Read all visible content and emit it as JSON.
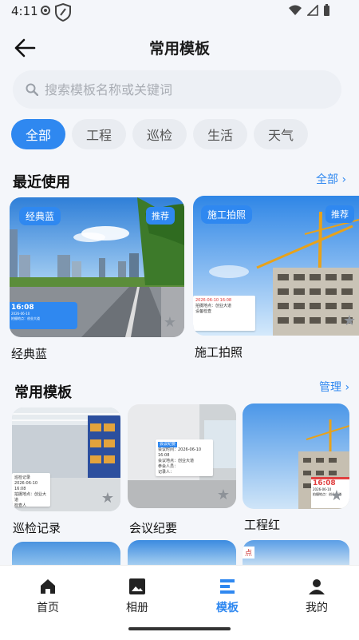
{
  "status": {
    "time": "4:11"
  },
  "header": {
    "title": "常用模板"
  },
  "search": {
    "placeholder": "搜索模板名称或关键词"
  },
  "chips": [
    "全部",
    "工程",
    "巡检",
    "生活",
    "天气"
  ],
  "recent": {
    "title": "最近使用",
    "more": "全部 ›",
    "cards": [
      {
        "label": "经典蓝",
        "tag": "经典蓝",
        "recommend": "推荐",
        "overlay_time": "16:08",
        "overlay_lines": [
          "2026-06-10",
          "拍摄地点：创业大道"
        ]
      },
      {
        "label": "施工拍照",
        "tag": "施工拍照",
        "recommend": "推荐",
        "overlay_time": "2026-06-10 16:08",
        "overlay_lines": [
          "拍摄地点：创业大道",
          "设备检查"
        ]
      }
    ]
  },
  "common": {
    "title": "常用模板",
    "manage": "管理 ›",
    "cards": [
      {
        "label": "巡检记录",
        "overlay_lines": [
          "巡检记录",
          "2026-06-10 16:08",
          "拍摄地点：创业大道",
          "检查人",
          "已正常"
        ]
      },
      {
        "label": "会议纪要",
        "overlay_lines": [
          "会议纪要",
          "会议时间：2026-06-10 16:08",
          "会议地点：创业大道",
          "参会人员：",
          "记录人：",
          "一切正常"
        ]
      },
      {
        "label": "工程红",
        "overlay_time": "16:08",
        "overlay_lines": [
          "2026-06-10",
          "拍摄地点：创业大道"
        ]
      }
    ],
    "partial_tag": "点"
  },
  "nav": {
    "items": [
      {
        "label": "首页",
        "icon": "home-icon"
      },
      {
        "label": "相册",
        "icon": "album-icon"
      },
      {
        "label": "模板",
        "icon": "template-icon"
      },
      {
        "label": "我的",
        "icon": "profile-icon"
      }
    ],
    "active_color": "#2f88f0"
  },
  "colors": {
    "accent": "#2f88f0"
  }
}
